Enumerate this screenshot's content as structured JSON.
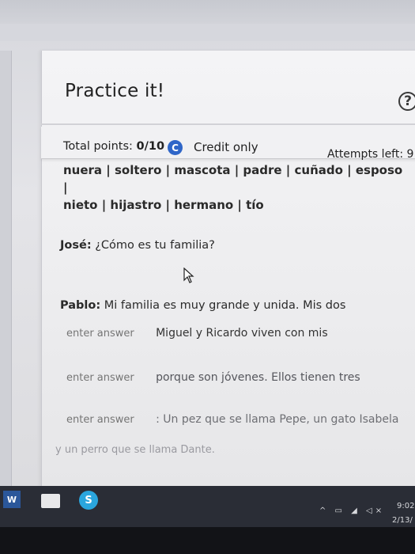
{
  "header": {
    "title": "Practice it!",
    "help_icon": "question-circle-icon",
    "help_glyph": "?"
  },
  "status": {
    "total_points_label": "Total points: ",
    "total_points_value": "0/10",
    "credit_glyph": "C",
    "credit_label": "Credit only",
    "attempts": "Attempts left: 9"
  },
  "word_bank": {
    "line1": "nuera | soltero | mascota | padre | cuñado | esposo |",
    "line2": "nieto | hijastro | hermano | tío"
  },
  "dialog": {
    "jose_speaker": "José:",
    "jose_text": " ¿Cómo es tu familia?",
    "pablo_speaker": "Pablo:",
    "pablo_text": " Mi familia es muy grande y unida. Mis dos",
    "blank1_placeholder": "enter answer",
    "blank1_after": "Miguel y Ricardo viven con mis",
    "blank2_placeholder": "enter answer",
    "blank2_after": "porque son jóvenes. Ellos tienen tres",
    "blank3_placeholder": "enter answer",
    "blank3_after": ": Un pez que se llama Pepe, un gato Isabela",
    "tail": "y un perro que se llama Dante."
  },
  "taskbar": {
    "word_label": "W",
    "skype_label": "S",
    "tray_icons": "^ ▭ ◢ ◁×",
    "time": "9:02",
    "date": "2/13/"
  }
}
